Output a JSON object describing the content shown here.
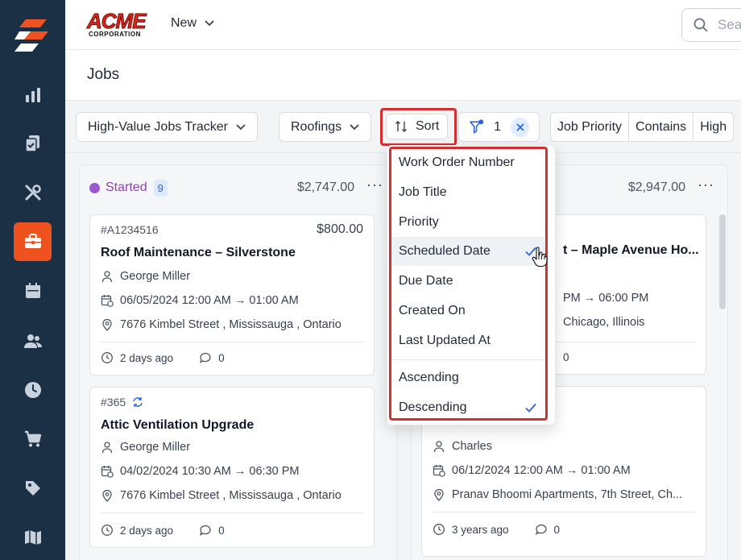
{
  "brand": {
    "logo_text": "ACME",
    "logo_sub": "CORPORATION"
  },
  "header": {
    "new_label": "New",
    "search_placeholder": "Search"
  },
  "page": {
    "title": "Jobs"
  },
  "sidebar": {
    "items": [
      {
        "icon": "chart-bar-icon"
      },
      {
        "icon": "clipboard-icon"
      },
      {
        "icon": "tools-icon"
      },
      {
        "icon": "briefcase-icon",
        "active": true
      },
      {
        "icon": "calendar-icon"
      },
      {
        "icon": "users-icon"
      },
      {
        "icon": "clock-icon"
      },
      {
        "icon": "cart-icon"
      },
      {
        "icon": "tag-icon"
      },
      {
        "icon": "map-icon"
      }
    ]
  },
  "filters": {
    "view": "High-Value Jobs Tracker",
    "category": "Roofings",
    "sort_label": "Sort",
    "filter_count": "1",
    "rule": {
      "field": "Job Priority",
      "operator": "Contains",
      "value": "High"
    }
  },
  "columns": [
    {
      "status": "Started",
      "count": "9",
      "total": "$2,747.00",
      "cards": [
        {
          "id": "#A1234516",
          "amount": "$800.00",
          "title": "Roof Maintenance – Silverstone",
          "assignee": "George Miller",
          "schedule": "06/05/2024 12:00 AM → 01:00 AM",
          "address": "7676 Kimbel Street , Mississauga , Ontario",
          "age": "2 days ago",
          "comments": "0"
        },
        {
          "id": "#365",
          "amount": "",
          "title": "Attic Ventilation Upgrade",
          "assignee": "George Miller",
          "schedule": "04/02/2024 10:30 AM → 06:30 PM",
          "address": "7676 Kimbel Street , Mississauga , Ontario",
          "age": "2 days ago",
          "comments": "0"
        }
      ]
    },
    {
      "status": "",
      "count": "",
      "total": "$2,947.00",
      "cards": [
        {
          "title_partial": "t – Maple Avenue Ho...",
          "schedule_partial": "PM → 06:00 PM",
          "address_partial": "Chicago, Illinois",
          "comments": "0"
        },
        {
          "assignee": "Charles",
          "schedule": "06/12/2024 12:00 AM → 01:00 AM",
          "address": "Pranav Bhoomi Apartments, 7th Street, Ch...",
          "age": "3 years ago",
          "comments": "0"
        }
      ]
    }
  ],
  "sort_menu": {
    "fields": [
      "Work Order Number",
      "Job Title",
      "Priority",
      "Scheduled Date",
      "Due Date",
      "Created On",
      "Last Updated At"
    ],
    "selected_field": "Scheduled Date",
    "directions": [
      "Ascending",
      "Descending"
    ],
    "selected_direction": "Descending"
  },
  "colors": {
    "sidebar": "#1b2f45",
    "accent": "#f0521f",
    "highlight_outline": "#d32f2f",
    "status_started": "#9b59d0",
    "link_blue": "#2563eb"
  }
}
